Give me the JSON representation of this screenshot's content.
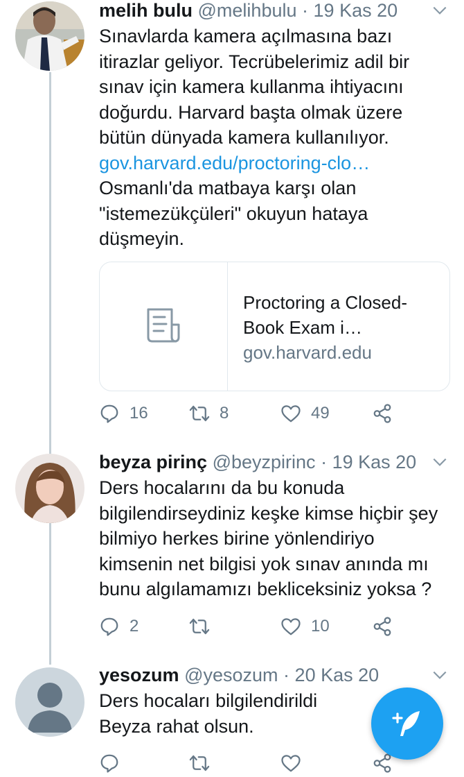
{
  "tweets": [
    {
      "name": "melih bulu",
      "handle": "@melihbulu",
      "separator": "·",
      "date": "19 Kas 20",
      "text_before_link": "Sınavlarda kamera açılmasına bazı itirazlar geliyor. Tecrübelerimiz adil bir sınav için kamera kullanma ihtiyacını doğurdu. Harvard başta olmak üzere bütün dünyada kamera kullanılıyor.",
      "link": "gov.harvard.edu/proctoring-clo…",
      "text_after_link": "Osmanlı'da matbaya karşı olan \"istemezükçüleri\" okuyun hataya düşmeyin.",
      "card": {
        "title": "Proctoring a Closed-Book Exam i…",
        "domain": "gov.harvard.edu",
        "icon": "document-icon"
      },
      "replies": "16",
      "retweets": "8",
      "likes": "49"
    },
    {
      "name": "beyza pirinç",
      "handle": "@beyzpirinc",
      "separator": "·",
      "date": "19 Kas 20",
      "text": "Ders hocalarını da bu konuda bilgilendirseydiniz keşke kimse hiçbir şey bilmiyo herkes birine yönlendiriyo kimsenin net bilgisi yok sınav anında mı bunu algılamamızı bekliceksiniz yoksa ?",
      "replies": "2",
      "retweets": "",
      "likes": "10"
    },
    {
      "name": "yesozum",
      "handle": "@yesozum",
      "separator": "·",
      "date": "20 Kas 20",
      "text": "Ders hocaları bilgilendirildi Beyza rahat olsun.",
      "replies": "",
      "retweets": "",
      "likes": ""
    }
  ],
  "colors": {
    "link": "#1b95e0",
    "fab": "#1da1f2",
    "muted": "#657786"
  },
  "fab": {
    "icon": "compose-tweet-icon"
  }
}
